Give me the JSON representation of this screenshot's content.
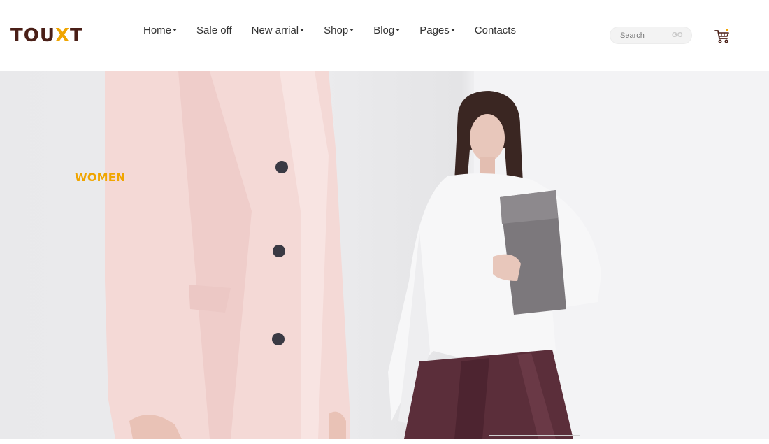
{
  "brand": {
    "logo_text_left": "TOU",
    "logo_text_right": "T",
    "logo_mark": "X"
  },
  "nav": {
    "items": [
      {
        "label": "Home",
        "has_dropdown": true
      },
      {
        "label": "Sale off",
        "has_dropdown": false
      },
      {
        "label": "New arrial",
        "has_dropdown": true
      },
      {
        "label": "Shop",
        "has_dropdown": true
      },
      {
        "label": "Blog",
        "has_dropdown": true
      },
      {
        "label": "Pages",
        "has_dropdown": true
      },
      {
        "label": "Contacts",
        "has_dropdown": false
      }
    ]
  },
  "search": {
    "placeholder": "Search",
    "button_label": "GO"
  },
  "cart": {
    "icon": "shopping-cart-icon"
  },
  "hero": {
    "label": "WOMEN"
  },
  "colors": {
    "brand": "#4a1f17",
    "accent": "#f0a500",
    "text": "#333333"
  }
}
